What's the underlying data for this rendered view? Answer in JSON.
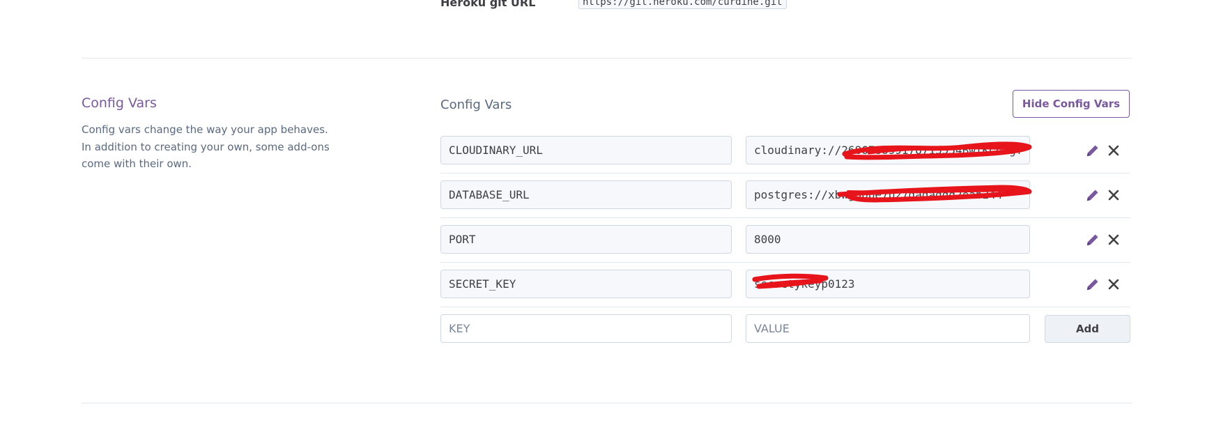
{
  "git": {
    "label": "Heroku git URL",
    "url": "https://git.heroku.com/curdine.git"
  },
  "config_section": {
    "title": "Config Vars",
    "description": "Config vars change the way your app behaves. In addition to creating your own, some add-ons come with their own."
  },
  "panel": {
    "title": "Config Vars",
    "hide_button": "Hide Config Vars"
  },
  "vars": [
    {
      "key": "CLOUDINARY_URL",
      "value": "cloudinary://268678899178713554BwfKCbtgT"
    },
    {
      "key": "DATABASE_URL",
      "value": "postgres://xbwg6ppe7b27dadaddd2eab244"
    },
    {
      "key": "PORT",
      "value": "8000"
    },
    {
      "key": "SECRET_KEY",
      "value": "secretykeyp0123"
    }
  ],
  "new_var": {
    "key_placeholder": "KEY",
    "value_placeholder": "VALUE",
    "add_button": "Add"
  },
  "colors": {
    "brand_purple": "#79589f",
    "redaction": "#e8141c"
  },
  "icons": {
    "edit": "pencil-icon",
    "delete": "close-icon"
  }
}
